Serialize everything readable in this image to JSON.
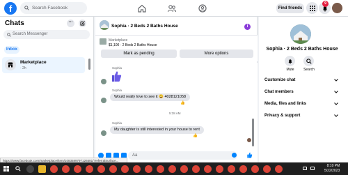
{
  "topbar": {
    "logo_letter": "f",
    "search_placeholder": "Search Facebook",
    "find_friends_label": "Find friends",
    "notifications_count": "9",
    "nav_icons": [
      "home-icon",
      "friends-icon",
      "groups-icon"
    ]
  },
  "sidebar": {
    "title": "Chats",
    "menu_glyph": "···",
    "search_placeholder": "Search Messenger",
    "inbox_tab": "Inbox",
    "chats": [
      {
        "name": "Marketplace",
        "time": "· 2h"
      }
    ]
  },
  "conversation": {
    "title": "Sophia · 2 Beds 2 Baths House",
    "info_glyph": "i",
    "listing": {
      "tag": "Marketplace",
      "summary": "$1,100 · 2 Beds 2 Baths House"
    },
    "mark_pending_label": "Mark as pending",
    "more_options_label": "More options",
    "messages": [
      {
        "sender": "Sophia",
        "text": "",
        "kind": "thumbs-up"
      },
      {
        "sender": "Sophia",
        "text": "Would really love to see it 😀 4028121058",
        "reaction": "👍"
      },
      {
        "sender": "Sophia",
        "text": "My daughter is still interested in your house to rent",
        "reaction": "👍"
      }
    ],
    "timestamp": "5:38 AM",
    "composer_placeholder": "Aa"
  },
  "details": {
    "title": "Sophia · 2 Beds 2 Baths House",
    "mute_label": "Mute",
    "search_label": "Search",
    "sections": [
      "Customize chat",
      "Chat members",
      "Media, files and links",
      "Privacy & support"
    ]
  },
  "status_url": "https://www.facebook.com/marketplace/item/1083589797126581/?referralSurface...",
  "taskbar": {
    "time": "8:10 PM",
    "date": "5/22/2023"
  },
  "colors": {
    "brand": "#1877f2",
    "messenger_blue": "#0084ff",
    "badge": "#e41e3f",
    "info": "#8b3dd9"
  }
}
